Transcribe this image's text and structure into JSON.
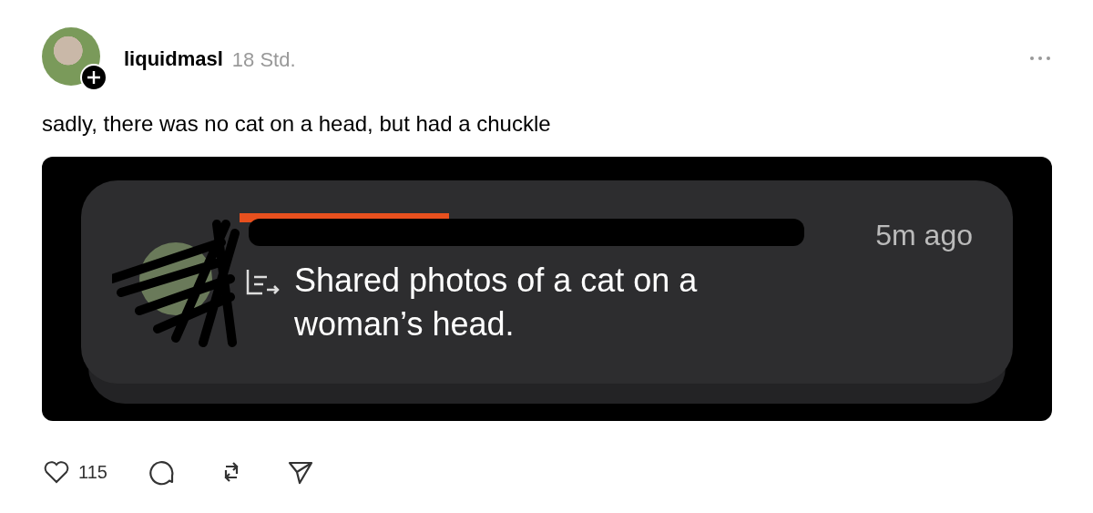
{
  "post": {
    "author": "liquidmasl",
    "time": "18 Std.",
    "text": "sadly, there was no cat on a head, but had a chuckle",
    "embed": {
      "time": "5m ago",
      "text": "Shared photos of a cat on a woman’s head."
    },
    "likes": "115"
  }
}
